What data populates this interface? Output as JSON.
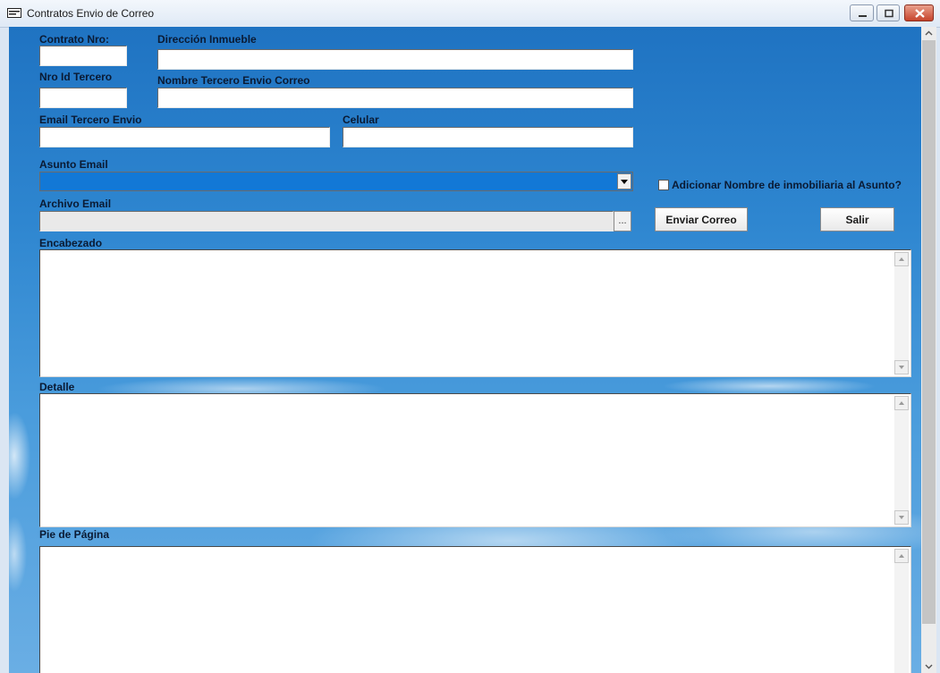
{
  "window": {
    "title": "Contratos Envio de Correo"
  },
  "colors": {
    "accent": "#1278d6",
    "close": "#c6442c"
  },
  "form": {
    "contrato_nro": {
      "label": "Contrato Nro:",
      "value": ""
    },
    "direccion_inmueble": {
      "label": "Dirección Inmueble",
      "value": ""
    },
    "nro_id_tercero": {
      "label": "Nro Id Tercero",
      "value": ""
    },
    "nombre_tercero": {
      "label": "Nombre Tercero Envio Correo",
      "value": ""
    },
    "email_tercero": {
      "label": "Email Tercero Envio",
      "value": ""
    },
    "celular": {
      "label": "Celular",
      "value": ""
    },
    "asunto_email": {
      "label": "Asunto Email",
      "value": ""
    },
    "adicionar_nombre": {
      "label": "Adicionar Nombre de inmobiliaria al Asunto?",
      "checked": false
    },
    "archivo_email": {
      "label": "Archivo Email",
      "value": "",
      "browse_label": "..."
    },
    "enviar_correo": {
      "label": "Enviar Correo"
    },
    "salir": {
      "label": "Salir"
    },
    "encabezado": {
      "label": "Encabezado",
      "value": ""
    },
    "detalle": {
      "label": "Detalle",
      "value": ""
    },
    "pie_pagina": {
      "label": "Pie de Página",
      "value": ""
    }
  }
}
